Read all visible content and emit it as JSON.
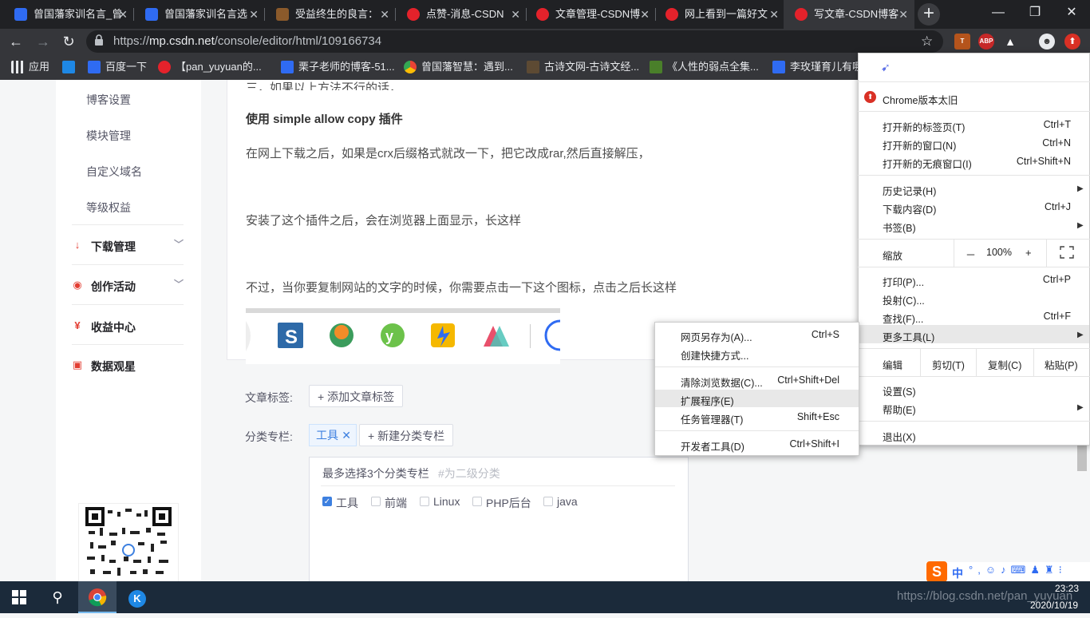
{
  "tabs": [
    {
      "title": "曾国藩家训名言_曾",
      "icon": "baidu-paw-icon"
    },
    {
      "title": "曾国藩家训名言选",
      "icon": "baidu-paw-icon"
    },
    {
      "title": "受益终生的良言：",
      "icon": "quwen-icon"
    },
    {
      "title": "点赞-消息-CSDN",
      "icon": "csdn-icon"
    },
    {
      "title": "文章管理-CSDN博",
      "icon": "csdn-icon"
    },
    {
      "title": "网上看到一篇好文",
      "icon": "csdn-icon"
    },
    {
      "title": "写文章-CSDN博客",
      "icon": "csdn-icon"
    }
  ],
  "window_controls": {
    "minimize": "—",
    "restore": "❐",
    "close": "✕"
  },
  "address": {
    "scheme": "https://",
    "host": "mp.csdn.net",
    "path": "/console/editor/html/109166734"
  },
  "extensions": {
    "abp": "ABP"
  },
  "bookmarks": [
    {
      "label": "应用"
    },
    {
      "label": ""
    },
    {
      "label": "百度一下"
    },
    {
      "label": "【pan_yuyuan的..."
    },
    {
      "label": "栗子老师的博客-51..."
    },
    {
      "label": "曾国藩智慧：遇到..."
    },
    {
      "label": "古诗文网-古诗文经..."
    },
    {
      "label": "《人性的弱点全集..."
    },
    {
      "label": "李玫瑾育儿有哪"
    }
  ],
  "sidebar": {
    "sub_items": [
      "博客设置",
      "模块管理",
      "自定义域名",
      "等级权益"
    ],
    "main_items": [
      "下载管理",
      "创作活动",
      "收益中心",
      "数据观星"
    ]
  },
  "editor": {
    "partial_line": "三，如果以上方法不行的话，",
    "heading": "使用 simple allow copy 插件",
    "p1": "在网上下载之后，如果是crx后缀格式就改一下，把它改成rar,然后直接解压，",
    "p2": "安装了这个插件之后，会在浏览器上面显示，长这样",
    "p3": "不过，当你要复制网站的文字的时候，你需要点击一下这个图标，点击之后长这样"
  },
  "form": {
    "tag_label": "文章标签:",
    "add_tag": "添加文章标签",
    "category_label": "分类专栏:",
    "selected_tag": "工具",
    "new_category": "新建分类专栏",
    "hint": "最多选择3个分类专栏",
    "hint_secondary": "#为二级分类",
    "checkboxes": [
      {
        "label": "工具",
        "checked": true
      },
      {
        "label": "前端",
        "checked": false
      },
      {
        "label": "Linux",
        "checked": false
      },
      {
        "label": "PHP后台",
        "checked": false
      },
      {
        "label": "java",
        "checked": false
      }
    ]
  },
  "chrome_menu": {
    "update": "Chrome版本太旧",
    "new_tab": "打开新的标签页(T)",
    "new_tab_key": "Ctrl+T",
    "new_window": "打开新的窗口(N)",
    "new_window_key": "Ctrl+N",
    "incognito": "打开新的无痕窗口(I)",
    "incognito_key": "Ctrl+Shift+N",
    "history": "历史记录(H)",
    "downloads": "下载内容(D)",
    "downloads_key": "Ctrl+J",
    "bookmarks": "书签(B)",
    "zoom": "缩放",
    "zoom_minus": "－",
    "zoom_value": "100%",
    "zoom_plus": "+",
    "print": "打印(P)...",
    "print_key": "Ctrl+P",
    "cast": "投射(C)...",
    "find": "查找(F)...",
    "find_key": "Ctrl+F",
    "more_tools": "更多工具(L)",
    "edit": "编辑",
    "cut": "剪切(T)",
    "copy": "复制(C)",
    "paste": "粘贴(P)",
    "settings": "设置(S)",
    "help": "帮助(E)",
    "exit": "退出(X)"
  },
  "submenu": {
    "save_as": "网页另存为(A)...",
    "save_as_key": "Ctrl+S",
    "shortcut": "创建快捷方式...",
    "clear_data": "清除浏览数据(C)...",
    "clear_data_key": "Ctrl+Shift+Del",
    "extensions": "扩展程序(E)",
    "task_manager": "任务管理器(T)",
    "task_manager_key": "Shift+Esc",
    "devtools": "开发者工具(D)",
    "devtools_key": "Ctrl+Shift+I"
  },
  "ime": {
    "lang": "中"
  },
  "taskbar": {
    "time": "23:23",
    "date": "2020/10/19",
    "watermark": "https://blog.csdn.net/pan_yuyuan"
  },
  "colors": {
    "csdn_red": "#e4222b",
    "accent_blue": "#3d80e0",
    "chrome_dark": "#35363a"
  }
}
